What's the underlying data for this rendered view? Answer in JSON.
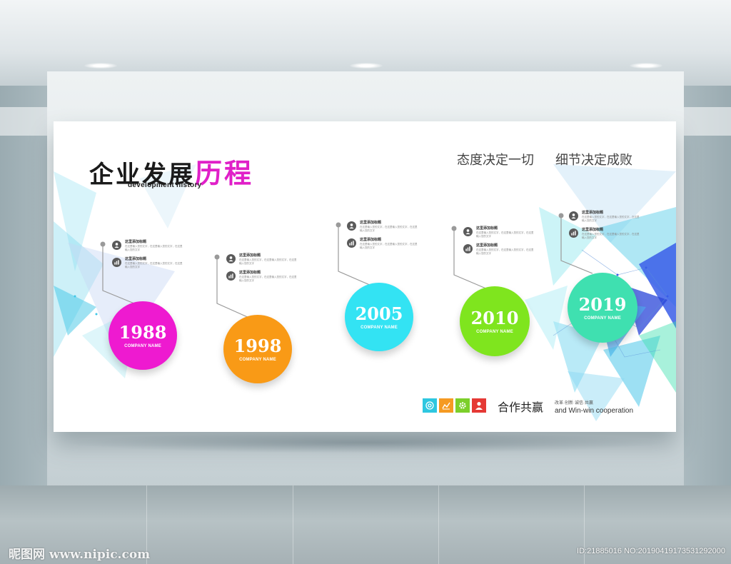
{
  "header": {
    "title_black": "企业发展",
    "title_accent": "历程",
    "subtitle": "development history",
    "motto_left": "态度决定一切",
    "motto_right": "细节决定成败"
  },
  "colors": {
    "accent_pink": "#e020c8",
    "circle_1988": "#ee1ad0",
    "circle_1998": "#f99a16",
    "circle_2005": "#33e3f3",
    "circle_2010": "#7fe51e",
    "circle_2019": "#3fe0b0"
  },
  "milestones": [
    {
      "year": "1988",
      "company": "COMPANY NAME",
      "items": [
        {
          "icon": "user-icon",
          "head": "这里添加标题",
          "body": "在这里输入您的文字，在这里输入您的文字，在这里输入您的文字"
        },
        {
          "icon": "chart-icon",
          "head": "这里添加标题",
          "body": "在这里输入您的文字，在这里输入您的文字，在这里输入您的文字"
        }
      ]
    },
    {
      "year": "1998",
      "company": "COMPANY NAME",
      "items": [
        {
          "icon": "user-icon",
          "head": "这里添加标题",
          "body": "在这里输入您的文字，在这里输入您的文字，在这里输入您的文字"
        },
        {
          "icon": "chart-icon",
          "head": "这里添加标题",
          "body": "在这里输入您的文字，在这里输入您的文字，在这里输入您的文字"
        }
      ]
    },
    {
      "year": "2005",
      "company": "COMPANY NAME",
      "items": [
        {
          "icon": "user-icon",
          "head": "这里添加标题",
          "body": "在这里输入您的文字，在这里输入您的文字，在这里输入您的文字"
        },
        {
          "icon": "chart-icon",
          "head": "这里添加标题",
          "body": "在这里输入您的文字，在这里输入您的文字，在这里输入您的文字"
        }
      ]
    },
    {
      "year": "2010",
      "company": "COMPANY NAME",
      "items": [
        {
          "icon": "user-icon",
          "head": "这里添加标题",
          "body": "在这里输入您的文字，在这里输入您的文字，在这里输入您的文字"
        },
        {
          "icon": "chart-icon",
          "head": "这里添加标题",
          "body": "在这里输入您的文字，在这里输入您的文字，在这里输入您的文字"
        }
      ]
    },
    {
      "year": "2019",
      "company": "COMPANY NAME",
      "items": [
        {
          "icon": "user-icon",
          "head": "这里添加标题",
          "body": "在这里输入您的文字，在这里输入您的文字，在这里输入您的文字"
        },
        {
          "icon": "chart-icon",
          "head": "这里添加标题",
          "body": "在这里输入您的文字，在这里输入您的文字，在这里输入您的文字"
        }
      ]
    }
  ],
  "footer": {
    "badges": [
      {
        "icon": "at-icon",
        "color": "#2ec7e0"
      },
      {
        "icon": "chart-icon",
        "color": "#f59a22"
      },
      {
        "icon": "gear-icon",
        "color": "#7ccf2a"
      },
      {
        "icon": "user-icon",
        "color": "#e53935"
      }
    ],
    "slogan": "合作共赢",
    "slogan_small": "改革·创新·诚信·共赢",
    "slogan_en": "and Win-win  cooperation"
  },
  "watermarks": {
    "left": "昵图网 www.nipic.com",
    "right": "ID:21885016 NO:20190419173531292000"
  }
}
